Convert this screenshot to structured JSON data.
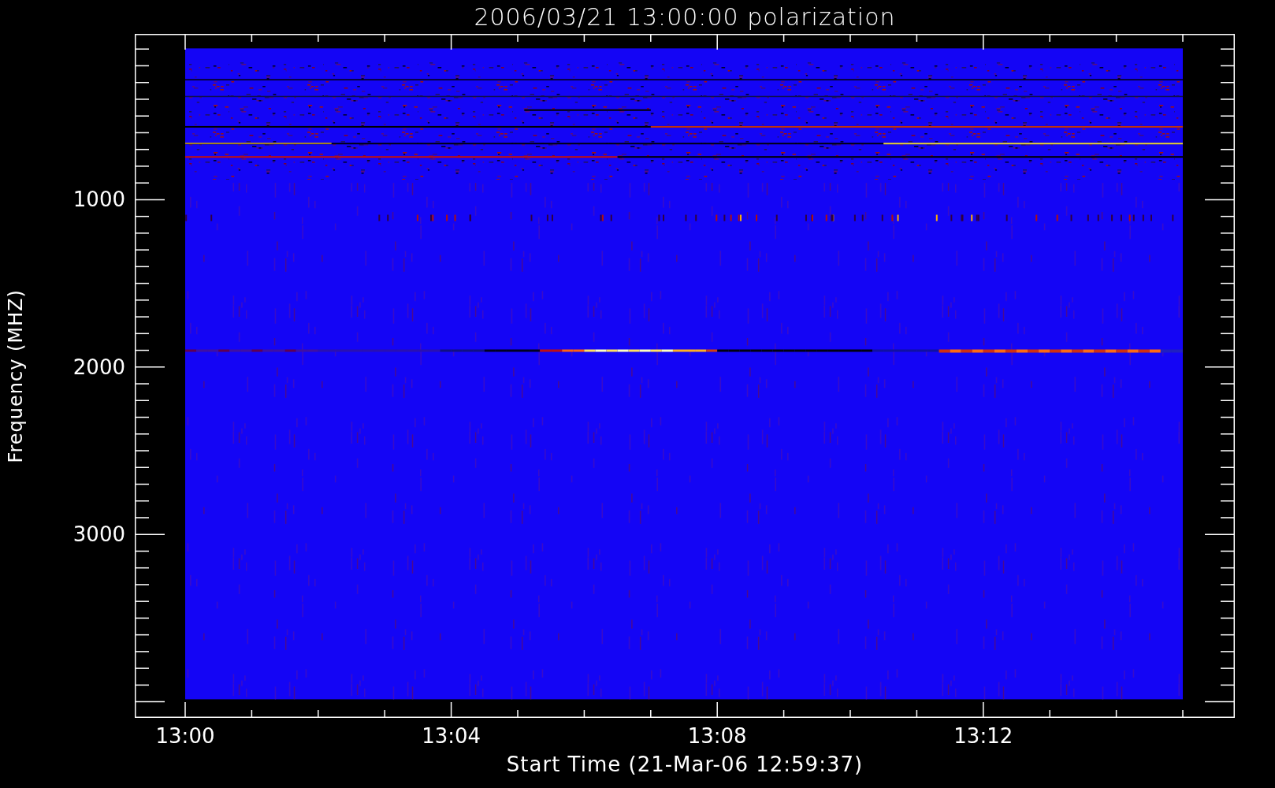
{
  "plot": {
    "title": "2006/03/21 13:00:00 polarization",
    "ylabel": "Frequency (MHZ)",
    "xlabel": "Start Time (21-Mar-06 12:59:37)",
    "xticks": [
      "13:00",
      "13:04",
      "13:08",
      "13:12"
    ],
    "yticks": [
      "1000",
      "2000",
      "3000"
    ]
  }
}
